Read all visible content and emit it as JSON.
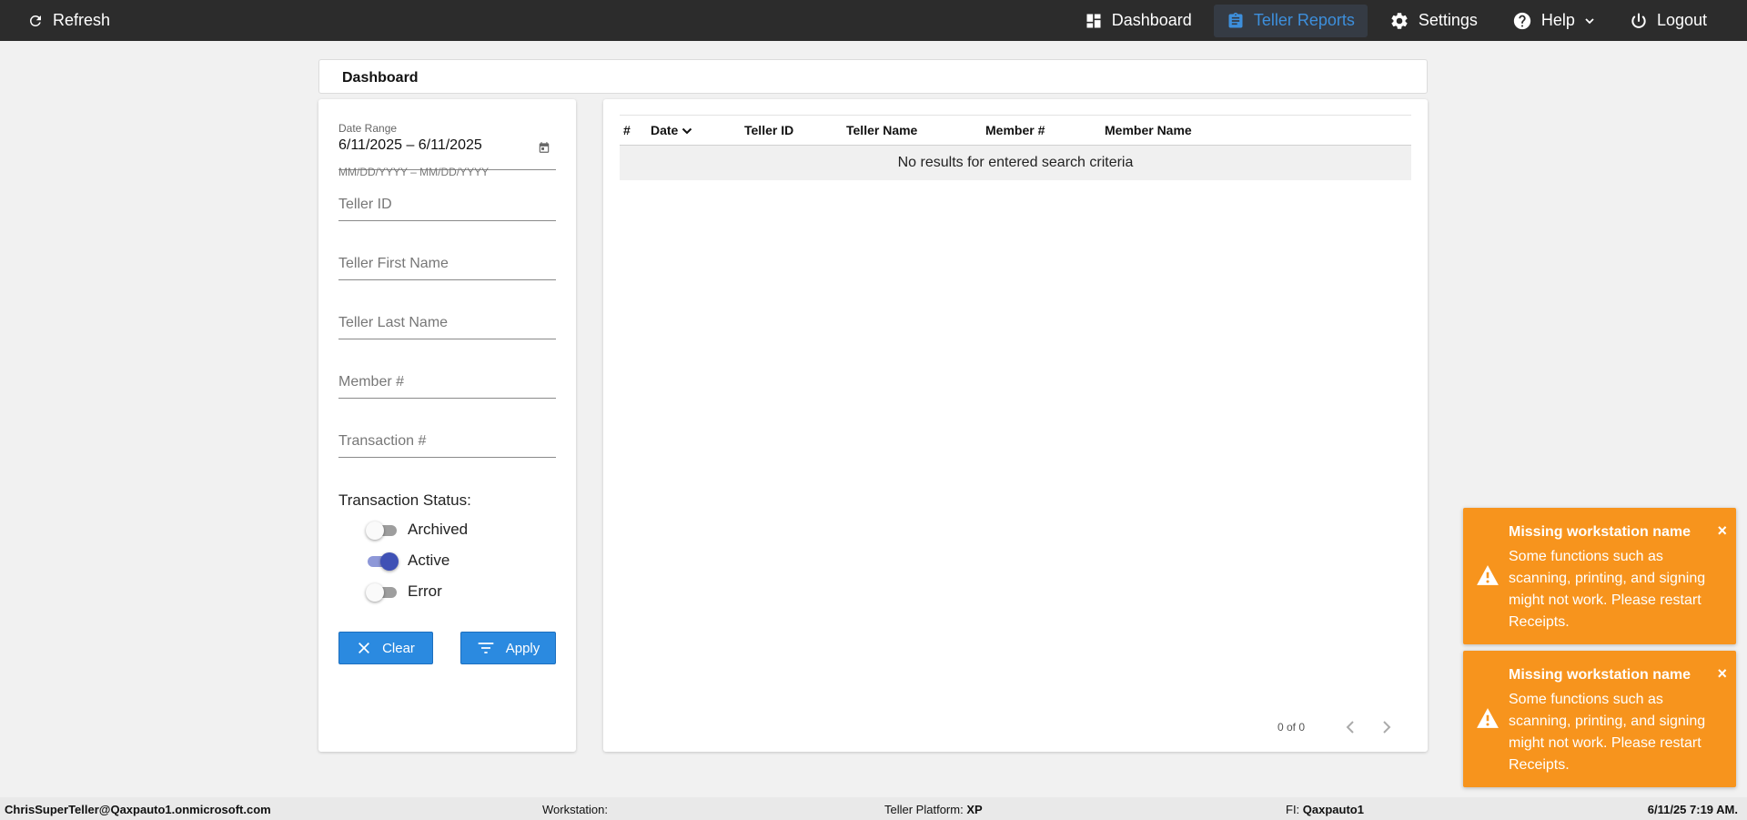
{
  "topbar": {
    "refresh_label": "Refresh",
    "nav": [
      {
        "label": "Dashboard",
        "icon": "dashboard-icon",
        "active": false
      },
      {
        "label": "Teller Reports",
        "icon": "clipboard-icon",
        "active": true
      },
      {
        "label": "Settings",
        "icon": "gear-icon",
        "active": false
      },
      {
        "label": "Help",
        "icon": "help-icon",
        "active": false
      },
      {
        "label": "Logout",
        "icon": "power-icon",
        "active": false
      }
    ],
    "accent_color": "#3d8fdc"
  },
  "page": {
    "title": "Dashboard"
  },
  "filters": {
    "date_range_label": "Date Range",
    "date_range_value": "6/11/2025 – 6/11/2025",
    "date_hint": "MM/DD/YYYY – MM/DD/YYYY",
    "teller_id_placeholder": "Teller ID",
    "teller_first_name_placeholder": "Teller First Name",
    "teller_last_name_placeholder": "Teller Last Name",
    "member_placeholder": "Member #",
    "transaction_placeholder": "Transaction #",
    "status_label": "Transaction Status:",
    "statuses": [
      {
        "label": "Archived",
        "on": false
      },
      {
        "label": "Active",
        "on": true
      },
      {
        "label": "Error",
        "on": false
      }
    ],
    "clear_label": "Clear",
    "apply_label": "Apply",
    "button_color": "#2b8ae0"
  },
  "results": {
    "columns": [
      "#",
      "Date",
      "Teller ID",
      "Teller Name",
      "Member #",
      "Member Name"
    ],
    "empty_message": "No results for entered search criteria",
    "pager_text": "0 of 0"
  },
  "toasts": [
    {
      "title": "Missing workstation name",
      "message": "Some functions such as scanning, printing, and signing might not work. Please restart Receipts.",
      "close": "×"
    },
    {
      "title": "Missing workstation name",
      "message": "Some functions such as scanning, printing, and signing might not work. Please restart Receipts.",
      "close": "×"
    }
  ],
  "toast_color": "#f7941d",
  "footer": {
    "user": "ChrisSuperTeller@Qaxpauto1.onmicrosoft.com",
    "workstation_label": "Workstation:",
    "workstation_value": "",
    "platform_label": "Teller Platform:",
    "platform_value": "XP",
    "fi_label": "FI:",
    "fi_value": "Qaxpauto1",
    "datetime": "6/11/25 7:19 AM."
  }
}
